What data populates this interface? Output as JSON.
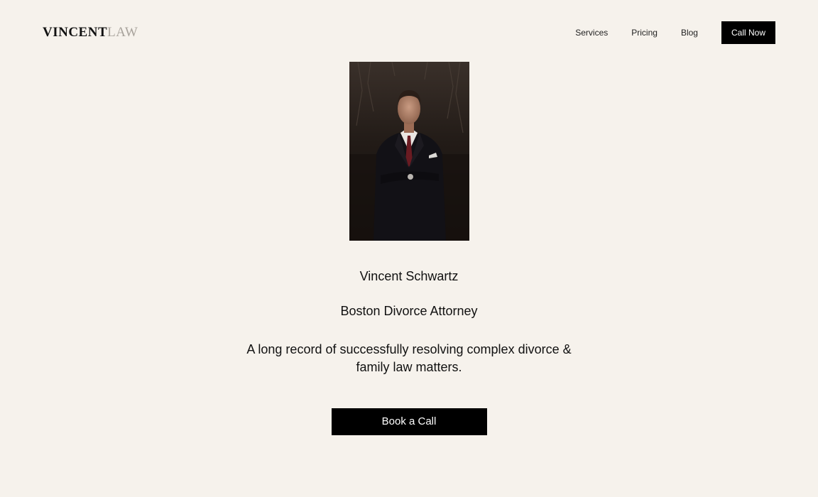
{
  "header": {
    "logo_primary": "VINCENT",
    "logo_secondary": "LAW",
    "nav": [
      {
        "label": "Services"
      },
      {
        "label": "Pricing"
      },
      {
        "label": "Blog"
      }
    ],
    "cta_label": "Call Now"
  },
  "hero": {
    "name": "Vincent Schwartz",
    "title": "Boston Divorce Attorney",
    "tagline": "A long record of successfully resolving complex divorce & family law matters.",
    "cta_label": "Book a Call"
  },
  "colors": {
    "background": "#f6f2ec",
    "button": "#000000",
    "logo_light": "#a8a39c"
  }
}
